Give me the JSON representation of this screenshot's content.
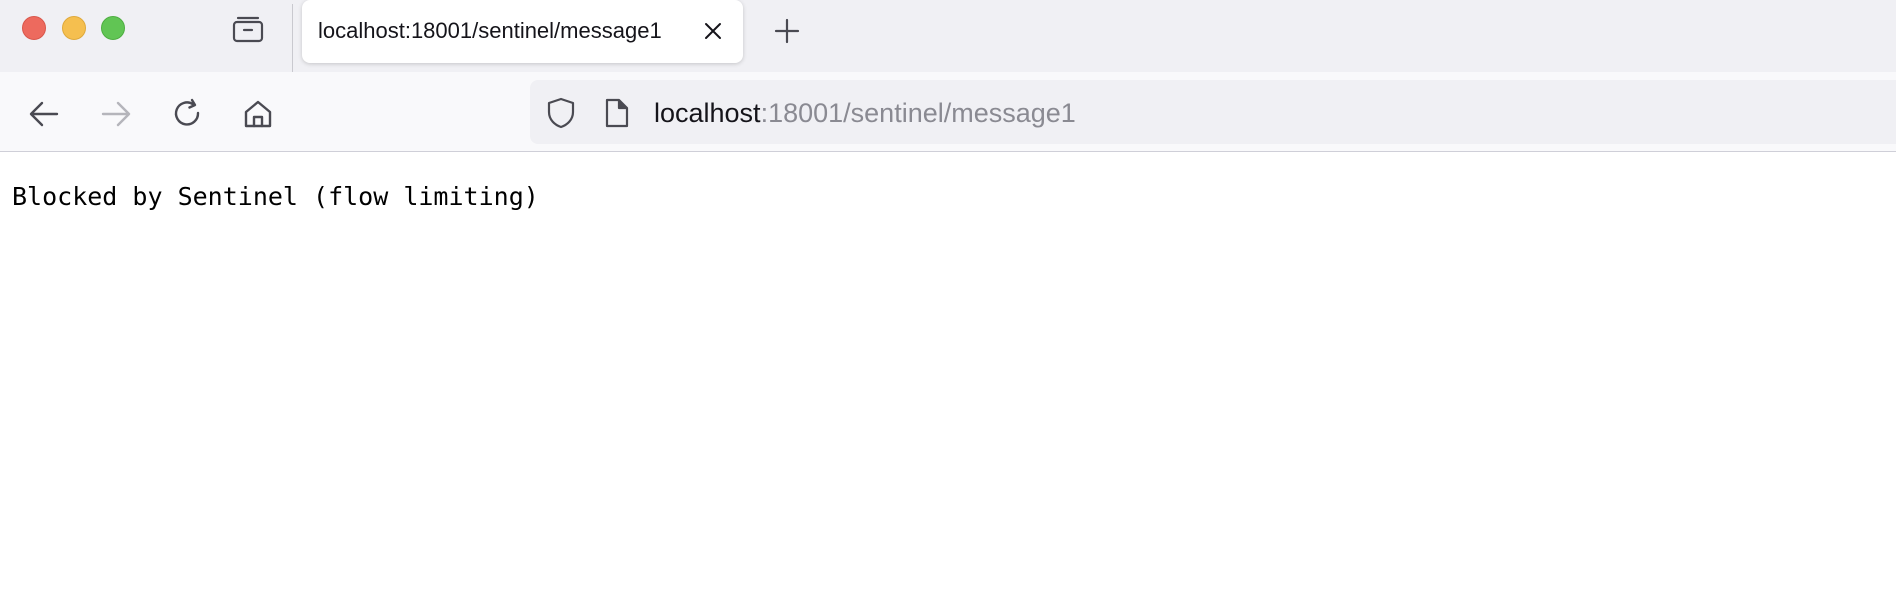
{
  "window": {
    "controls": [
      "close",
      "minimize",
      "maximize"
    ]
  },
  "tabstrip": {
    "tab_overview_icon": "tab-overview-icon",
    "tabs": [
      {
        "title": "localhost:18001/sentinel/message1",
        "active": true
      }
    ],
    "new_tab_icon": "plus-icon"
  },
  "navbar": {
    "back_icon": "arrow-left-icon",
    "forward_icon": "arrow-right-icon",
    "forward_enabled": false,
    "reload_icon": "reload-icon",
    "home_icon": "home-icon",
    "url": {
      "shield_icon": "shield-icon",
      "page_icon": "page-icon",
      "host": "localhost",
      "rest": ":18001/sentinel/message1"
    }
  },
  "page": {
    "body_text": "Blocked by Sentinel (flow limiting)"
  },
  "colors": {
    "tabstrip_bg": "#f0f0f4",
    "navbar_bg": "#f9f9fb",
    "close_red": "#ed6a5e",
    "minimize_yellow": "#f5bf4f",
    "maximize_green": "#61c554",
    "url_path_gray": "#8a8a92"
  }
}
